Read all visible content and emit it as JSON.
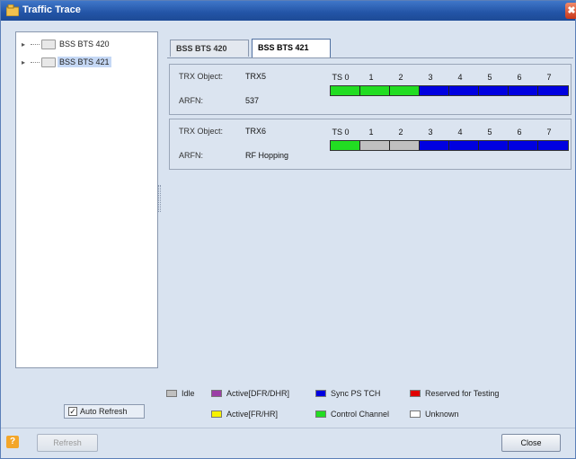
{
  "window": {
    "title": "Traffic Trace",
    "close_glyph": "✖"
  },
  "tree": {
    "items": [
      {
        "label": "BSS BTS 420",
        "selected": false
      },
      {
        "label": "BSS BTS 421",
        "selected": true
      }
    ]
  },
  "tabs": [
    {
      "label": "BSS BTS 420",
      "active": false
    },
    {
      "label": "BSS BTS 421",
      "active": true
    }
  ],
  "trx_panels": [
    {
      "object_label": "TRX Object:",
      "object_value": "TRX5",
      "arfn_label": "ARFN:",
      "arfn_value": "537",
      "ts_labels": [
        "TS 0",
        "1",
        "2",
        "3",
        "4",
        "5",
        "6",
        "7"
      ],
      "ts_states": [
        "control",
        "control",
        "control",
        "sync_ps_tch",
        "sync_ps_tch",
        "sync_ps_tch",
        "sync_ps_tch",
        "sync_ps_tch"
      ]
    },
    {
      "object_label": "TRX Object:",
      "object_value": "TRX6",
      "arfn_label": "ARFN:",
      "arfn_value": "RF Hopping",
      "ts_labels": [
        "TS 0",
        "1",
        "2",
        "3",
        "4",
        "5",
        "6",
        "7"
      ],
      "ts_states": [
        "control",
        "idle",
        "idle",
        "sync_ps_tch",
        "sync_ps_tch",
        "sync_ps_tch",
        "sync_ps_tch",
        "sync_ps_tch"
      ]
    }
  ],
  "legend": [
    {
      "label": "Idle",
      "color": "#c0c0c0"
    },
    {
      "label": "Active[DFR/DHR]",
      "color": "#9b3fa6"
    },
    {
      "label": "Sync PS TCH",
      "color": "#0000e0"
    },
    {
      "label": "Reserved for Testing",
      "color": "#e00000"
    },
    {
      "label": "Active[FR/HR]",
      "color": "#f7f200"
    },
    {
      "label": "Control Channel",
      "color": "#22dd22"
    },
    {
      "label": "Unknown",
      "color": "#ffffff"
    }
  ],
  "state_colors": {
    "idle": "#c0c0c0",
    "control": "#22dd22",
    "sync_ps_tch": "#0000e0",
    "active_dfr": "#9b3fa6",
    "active_fr": "#f7f200",
    "reserved": "#e00000",
    "unknown": "#ffffff"
  },
  "auto_refresh": {
    "label": "Auto Refresh",
    "checked": true
  },
  "buttons": {
    "refresh": "Refresh",
    "close": "Close"
  },
  "icons": {
    "app": "traffic-trace-app-icon",
    "help": "help-icon"
  }
}
